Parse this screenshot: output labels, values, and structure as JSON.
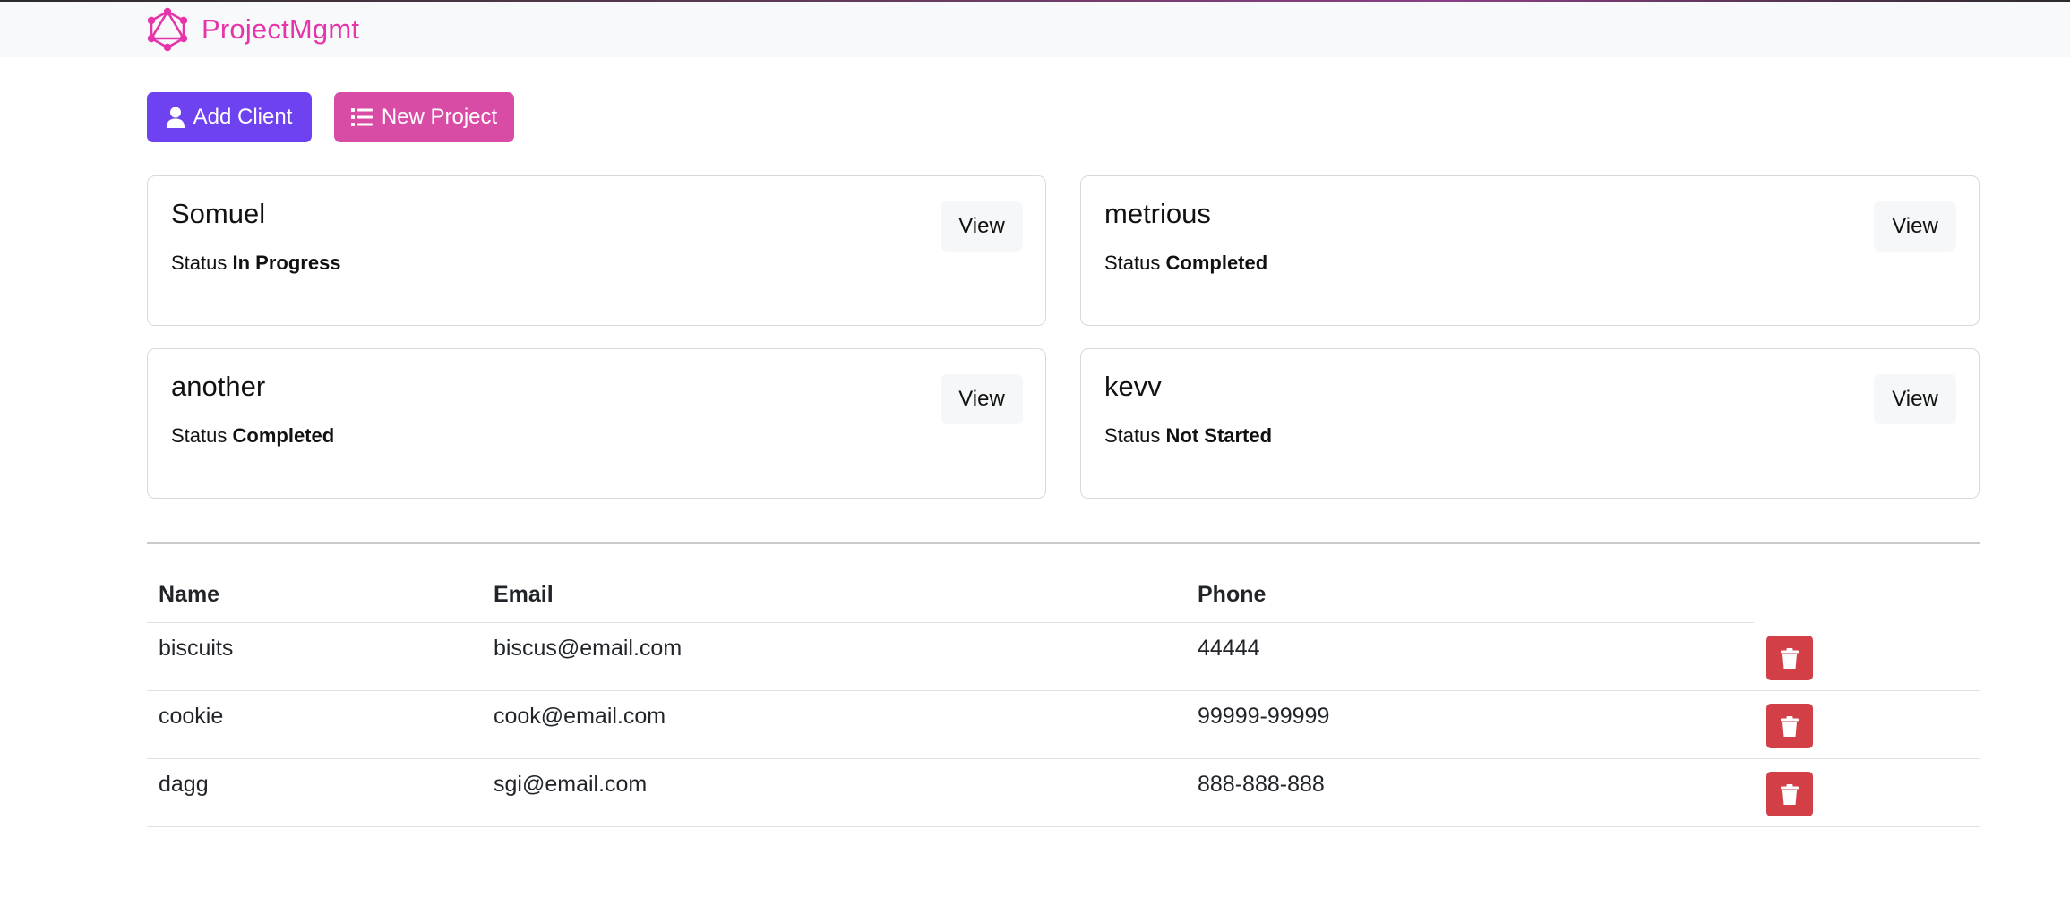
{
  "navbar": {
    "brand": "ProjectMgmt",
    "logo_icon": "graphql-logo-icon",
    "brand_color": "#e535ab"
  },
  "actions": {
    "add_client": {
      "label": "Add Client",
      "icon": "user-icon",
      "color": "#6f42f1"
    },
    "new_project": {
      "label": "New Project",
      "icon": "list-icon",
      "color": "#d94ca6"
    }
  },
  "projects": [
    {
      "name": "Somuel",
      "status_label": "Status",
      "status": "In Progress",
      "view_label": "View"
    },
    {
      "name": "metrious",
      "status_label": "Status",
      "status": "Completed",
      "view_label": "View"
    },
    {
      "name": "another",
      "status_label": "Status",
      "status": "Completed",
      "view_label": "View"
    },
    {
      "name": "kevv",
      "status_label": "Status",
      "status": "Not Started",
      "view_label": "View"
    }
  ],
  "clients_table": {
    "headers": [
      "Name",
      "Email",
      "Phone"
    ],
    "rows": [
      {
        "name": "biscuits",
        "email": "biscus@email.com",
        "phone": "44444"
      },
      {
        "name": "cookie",
        "email": "cook@email.com",
        "phone": "99999-99999"
      },
      {
        "name": "dagg",
        "email": "sgi@email.com",
        "phone": "888-888-888"
      }
    ],
    "delete_icon": "trash-icon",
    "delete_color": "#d23f47"
  }
}
